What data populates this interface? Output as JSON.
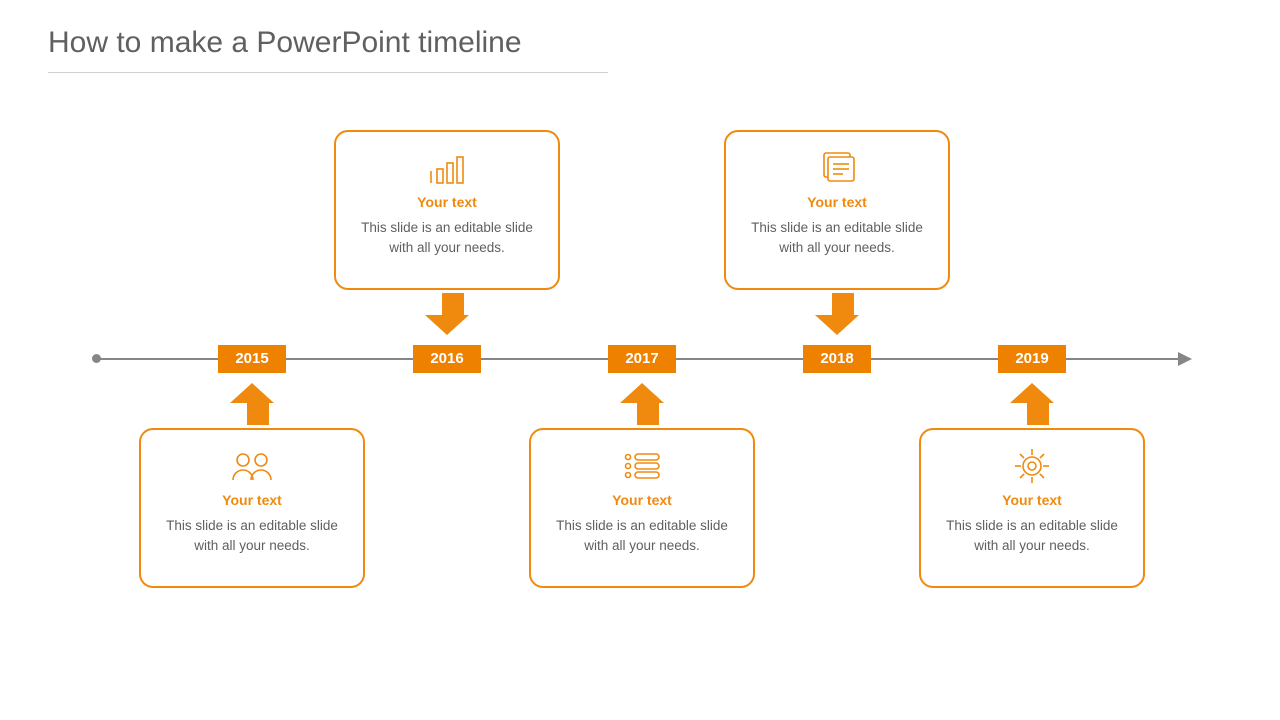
{
  "title": "How to make a PowerPoint timeline",
  "accent": "#ef8a0f",
  "timeline": {
    "years": [
      "2015",
      "2016",
      "2017",
      "2018",
      "2019"
    ],
    "items": [
      {
        "year_index": 0,
        "position": "below",
        "icon": "people",
        "label": "Your text",
        "desc": "This slide is an editable slide with all your needs."
      },
      {
        "year_index": 1,
        "position": "above",
        "icon": "bars",
        "label": "Your text",
        "desc": "This slide is an editable slide with all your needs."
      },
      {
        "year_index": 2,
        "position": "below",
        "icon": "list",
        "label": "Your text",
        "desc": "This slide is an editable slide with all your needs."
      },
      {
        "year_index": 3,
        "position": "above",
        "icon": "document",
        "label": "Your text",
        "desc": "This slide is an editable slide with all your needs."
      },
      {
        "year_index": 4,
        "position": "below",
        "icon": "gear",
        "label": "Your text",
        "desc": "This slide is an editable slide with all your needs."
      }
    ]
  }
}
